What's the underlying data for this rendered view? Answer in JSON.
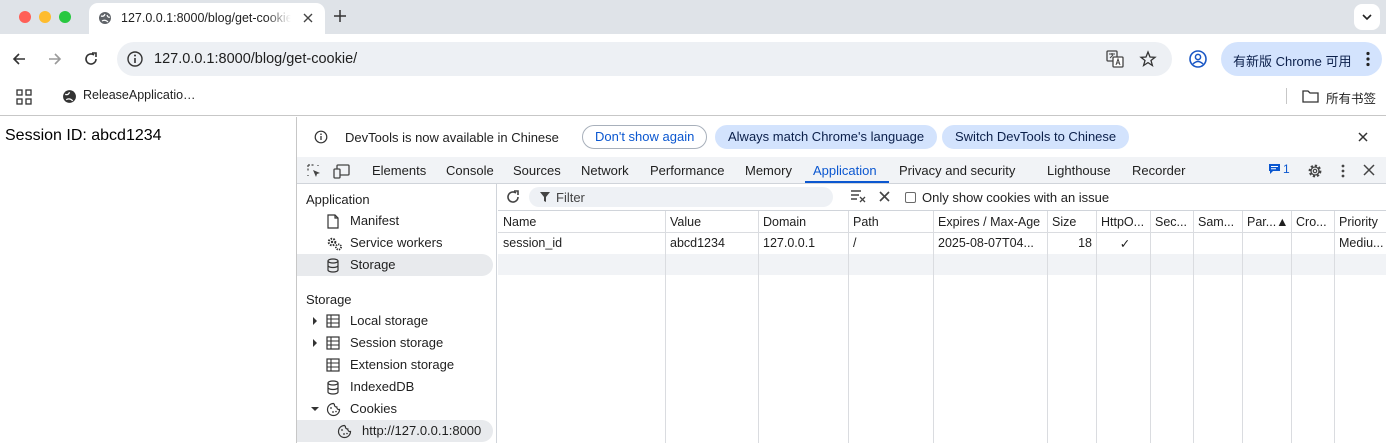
{
  "browser": {
    "tab": {
      "title": "127.0.0.1:8000/blog/get-cookie/"
    },
    "address": {
      "url": "127.0.0.1:8000/blog/get-cookie/"
    },
    "update_button": "有新版 Chrome 可用",
    "bookmarks": {
      "item": "ReleaseApplicatio…",
      "all_bookmarks": "所有书签"
    }
  },
  "page": {
    "session_text": "Session ID: abcd1234"
  },
  "devtools": {
    "infobar": {
      "message": "DevTools is now available in Chinese",
      "dont_show": "Don't show again",
      "always_match": "Always match Chrome's language",
      "switch": "Switch DevTools to Chinese"
    },
    "tabs": [
      "Elements",
      "Console",
      "Sources",
      "Network",
      "Performance",
      "Memory",
      "Application",
      "Privacy and security",
      "Lighthouse",
      "Recorder"
    ],
    "active_tab": "Application",
    "issues_count": "1",
    "sidebar": {
      "application_header": "Application",
      "application_items": [
        "Manifest",
        "Service workers",
        "Storage"
      ],
      "storage_header": "Storage",
      "storage_items": [
        "Local storage",
        "Session storage",
        "Extension storage",
        "IndexedDB",
        "Cookies"
      ],
      "cookie_origin": "http://127.0.0.1:8000"
    },
    "cookies": {
      "filter_placeholder": "Filter",
      "only_issues_label": "Only show cookies with an issue",
      "columns": [
        "Name",
        "Value",
        "Domain",
        "Path",
        "Expires / Max-Age",
        "Size",
        "HttpO...",
        "Sec...",
        "Sam...",
        "Par...▲",
        "Cro...",
        "Priority"
      ],
      "rows": [
        [
          "session_id",
          "abcd1234",
          "127.0.0.1",
          "/",
          "2025-08-07T04...",
          "18",
          "✓",
          "",
          "",
          "",
          "",
          "Mediu..."
        ]
      ]
    }
  },
  "colors": {
    "accent": "#0b57d0",
    "pill": "#d3e3fd",
    "tabstrip": "#dfe3e8"
  }
}
